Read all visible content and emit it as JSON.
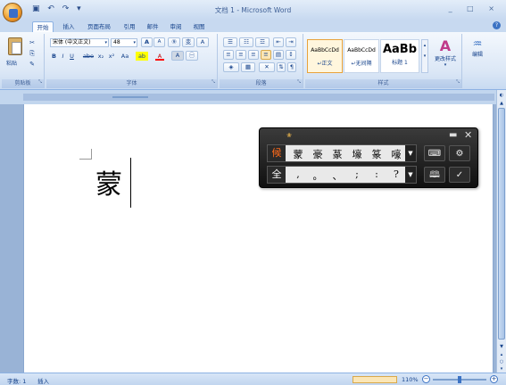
{
  "window": {
    "title": "文档 1 - Microsoft Word",
    "controls": "_ □ ×",
    "qat": "▣ ↶ ↷ ▾"
  },
  "tabs": [
    "开始",
    "插入",
    "页面布局",
    "引用",
    "邮件",
    "审阅",
    "视图"
  ],
  "ribbon": {
    "clipboard": {
      "label": "剪贴板",
      "paste": "粘贴",
      "launcher": "⤡"
    },
    "font": {
      "label": "字体",
      "font_name": "宋体 (中文正文)",
      "font_size": "48",
      "row2": [
        "B",
        "I",
        "U",
        "abe",
        "x₂",
        "x²",
        "Aa",
        "ab",
        "A",
        "A",
        "㊀"
      ],
      "row1_btns": [
        "A",
        "A",
        "⑨",
        "变",
        "A"
      ],
      "launcher": "⤡"
    },
    "paragraph": {
      "label": "段落",
      "launcher": "⤡"
    },
    "styles": {
      "label": "样式",
      "items": [
        {
          "preview": "AaBbCcDd",
          "name": "↵正文",
          "selected": true
        },
        {
          "preview": "AaBbCcDd",
          "name": "↵无间隔",
          "selected": false
        },
        {
          "preview": "AaBb",
          "name": "标题 1",
          "selected": false
        }
      ],
      "change_styles": "更改样式",
      "launcher": "⤡"
    },
    "editing": {
      "label": "编辑"
    }
  },
  "document": {
    "text": "蒙"
  },
  "ime": {
    "logo": "❀",
    "candidates_flag": "候",
    "candidates": [
      "蒙",
      "豪",
      "蒃",
      "壕",
      "篆",
      "嚎"
    ],
    "punct_flag": "全",
    "punctuation": [
      ",",
      "。",
      "、",
      ";",
      ":",
      "?"
    ],
    "tools": [
      "⌨",
      "⚙",
      "🕮",
      "✓"
    ]
  },
  "status": {
    "word_count": "字数: 1",
    "mode": "插入",
    "zoom": "110%",
    "zoom_minus": "−",
    "zoom_plus": "+"
  }
}
